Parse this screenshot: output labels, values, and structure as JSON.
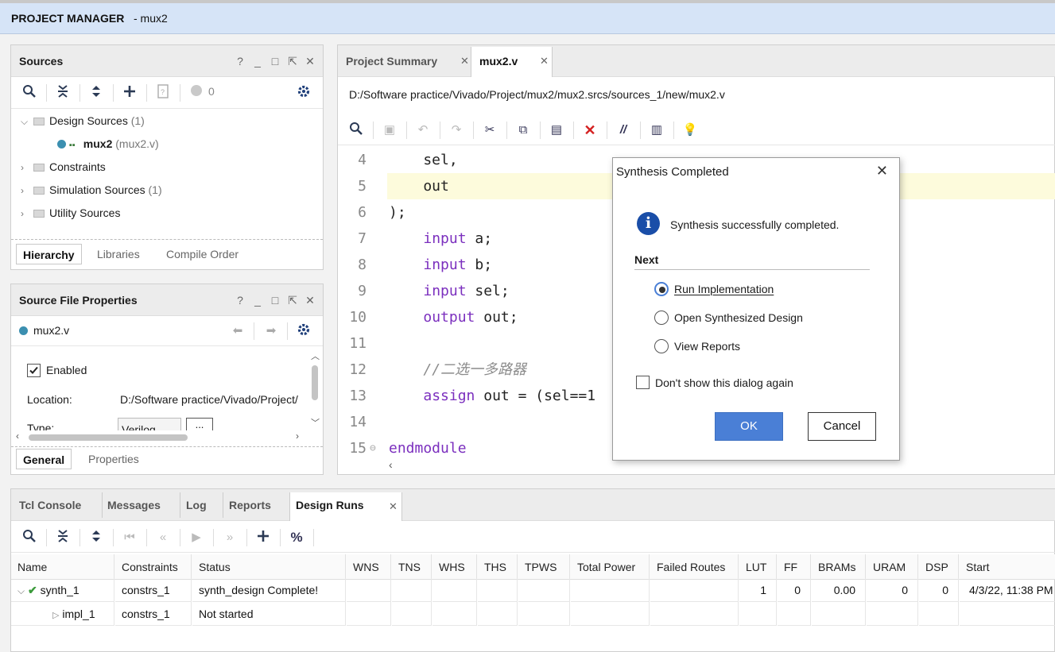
{
  "titlebar": {
    "title": "PROJECT MANAGER",
    "project": "- mux2"
  },
  "sources": {
    "title": "Sources",
    "window_controls": [
      "?",
      "_",
      "□",
      "⇱",
      "✕"
    ],
    "toolbar_count": "0",
    "tree": [
      {
        "label": "Design Sources",
        "count": "(1)",
        "expanded": true
      },
      {
        "label": "mux2",
        "detail": "(mux2.v)"
      },
      {
        "label": "Constraints",
        "count": ""
      },
      {
        "label": "Simulation Sources",
        "count": "(1)"
      },
      {
        "label": "Utility Sources",
        "count": ""
      }
    ],
    "tabs": [
      "Hierarchy",
      "Libraries",
      "Compile Order"
    ]
  },
  "props": {
    "title": "Source File Properties",
    "file": "mux2.v",
    "enabled_label": "Enabled",
    "location_label": "Location:",
    "location_value": "D:/Software practice/Vivado/Project/",
    "type_label": "Type:",
    "type_value": "Verilog",
    "more_button": "...",
    "tabs": [
      "General",
      "Properties"
    ]
  },
  "editor": {
    "tabs": [
      {
        "label": "Project Summary"
      },
      {
        "label": "mux2.v"
      }
    ],
    "path": "D:/Software practice/Vivado/Project/mux2/mux2.srcs/sources_1/new/mux2.v",
    "lines": [
      {
        "n": "4",
        "text": "    sel,"
      },
      {
        "n": "5",
        "text": "    out"
      },
      {
        "n": "6",
        "text": ");"
      },
      {
        "n": "7",
        "kw": "input",
        "rest": " a;"
      },
      {
        "n": "8",
        "kw": "input",
        "rest": " b;"
      },
      {
        "n": "9",
        "kw": "input",
        "rest": " sel;"
      },
      {
        "n": "10",
        "kw": "output",
        "rest": " out;"
      },
      {
        "n": "11",
        "text": ""
      },
      {
        "n": "12",
        "comment": "//二选一多路器"
      },
      {
        "n": "13",
        "kw": "assign",
        "rest": " out = (sel==1"
      },
      {
        "n": "14",
        "text": ""
      },
      {
        "n": "15",
        "kw": "endmodule",
        "rest": ""
      }
    ]
  },
  "dialog": {
    "title": "Synthesis Completed",
    "message": "Synthesis successfully completed.",
    "next_label": "Next",
    "options": [
      {
        "label": "Run Implementation",
        "selected": true
      },
      {
        "label": "Open Synthesized Design",
        "selected": false
      },
      {
        "label": "View Reports",
        "selected": false
      }
    ],
    "dont_show": "Don't show this dialog again",
    "ok": "OK",
    "cancel": "Cancel"
  },
  "bottom": {
    "tabs": [
      "Tcl Console",
      "Messages",
      "Log",
      "Reports",
      "Design Runs"
    ],
    "active_tab": "Design Runs",
    "columns": [
      "Name",
      "Constraints",
      "Status",
      "WNS",
      "TNS",
      "WHS",
      "THS",
      "TPWS",
      "Total Power",
      "Failed Routes",
      "LUT",
      "FF",
      "BRAMs",
      "URAM",
      "DSP",
      "Start"
    ],
    "rows": [
      {
        "name": "synth_1",
        "constraints": "constrs_1",
        "status": "synth_design Complete!",
        "lut": "1",
        "ff": "0",
        "brams": "0.00",
        "uram": "0",
        "dsp": "0",
        "start": "4/3/22, 11:38 PM"
      },
      {
        "name": "impl_1",
        "constraints": "constrs_1",
        "status": "Not started",
        "lut": "",
        "ff": "",
        "brams": "",
        "uram": "",
        "dsp": "",
        "start": ""
      }
    ]
  },
  "colors": {
    "accent": "#4a7fd6",
    "titlebar": "#d6e4f7",
    "keyword": "#7b2fbe",
    "highlight_line": "#fdfbdc"
  }
}
